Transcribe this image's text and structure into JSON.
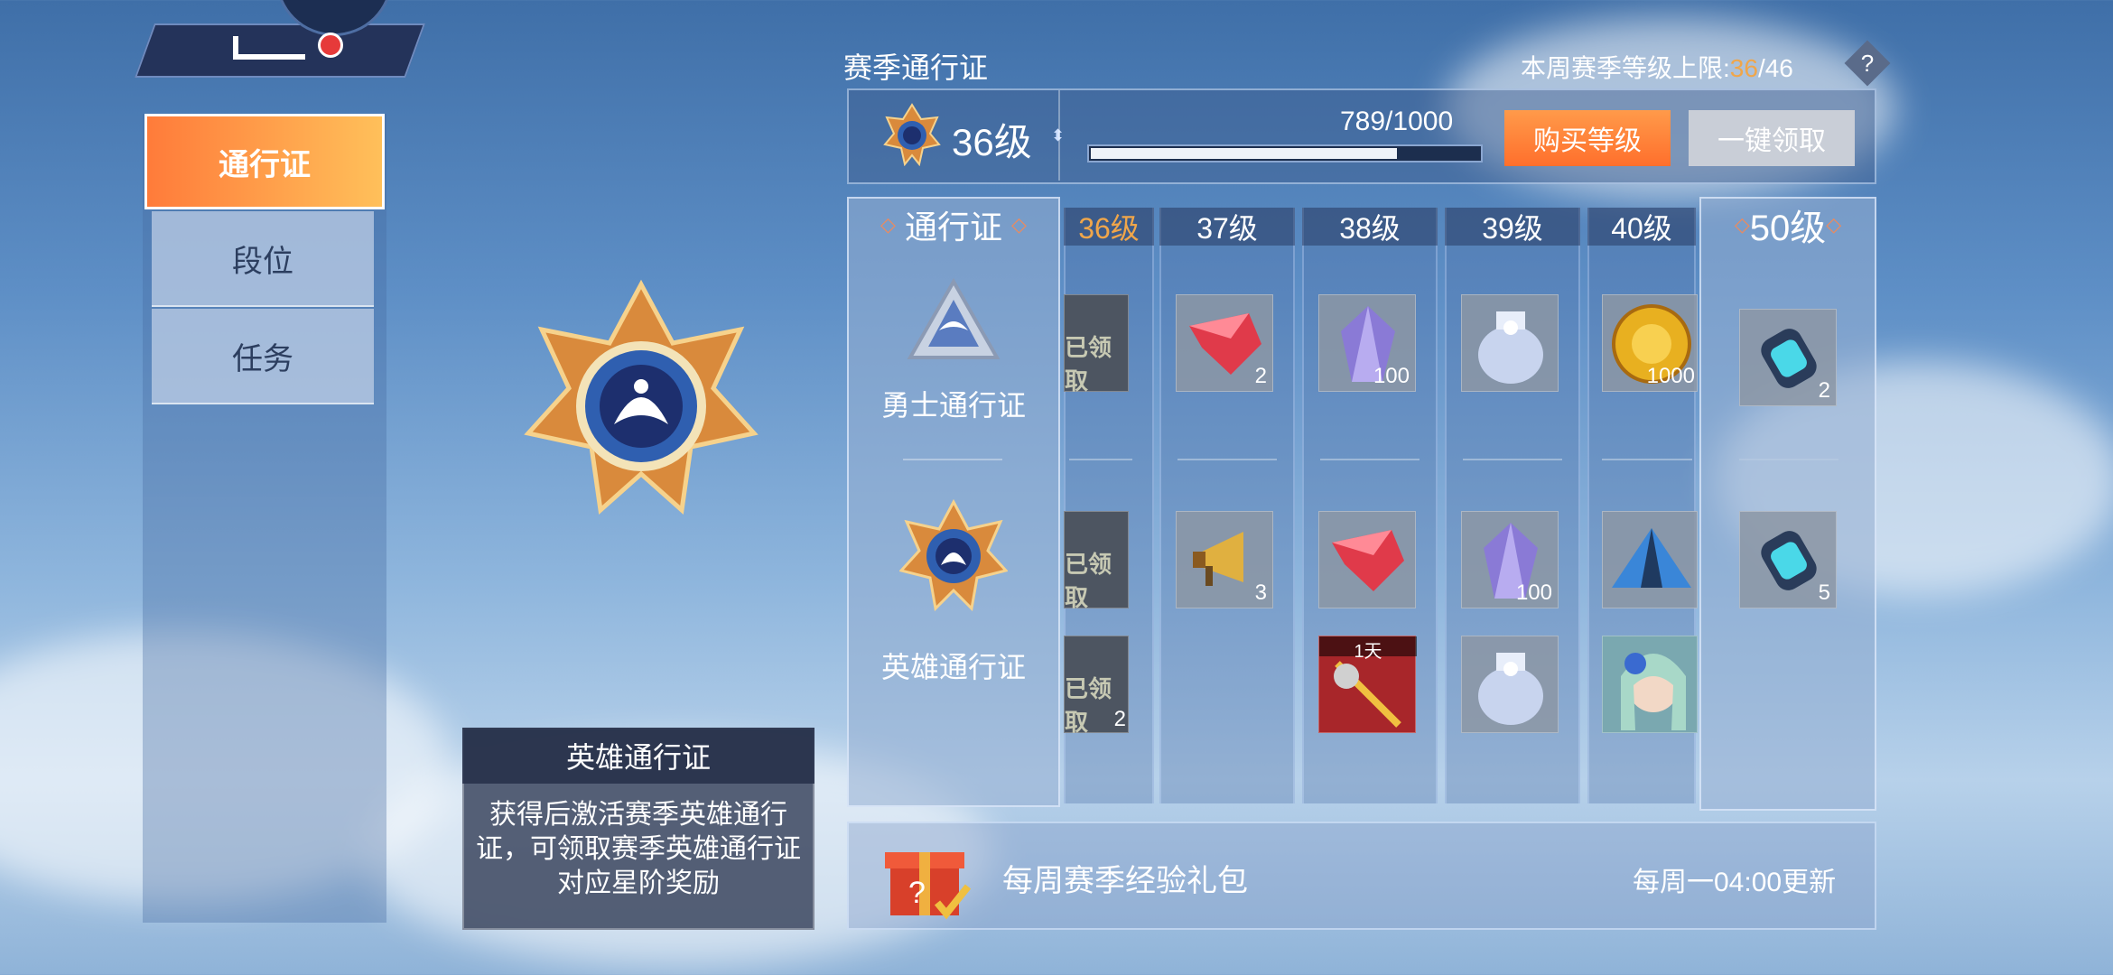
{
  "nav": {
    "tabs": [
      {
        "label": "通行证"
      },
      {
        "label": "段位"
      },
      {
        "label": "任务"
      }
    ]
  },
  "tooltip": {
    "title": "英雄通行证",
    "description": "获得后激活赛季英雄通行证，可领取赛季英雄通行证对应星阶奖励"
  },
  "header": {
    "title": "赛季通行证",
    "weekly_cap_label": "本周赛季等级上限:",
    "weekly_cap_current": "36",
    "weekly_cap_max": "/46",
    "help": "?"
  },
  "level": {
    "text": "36级",
    "xp": "789/1000",
    "progress": 0.789,
    "buy_label": "购买等级",
    "claim_label": "一键领取"
  },
  "pass_column": {
    "header": "通行证",
    "free_label": "勇士通行证",
    "hero_label": "英雄通行证"
  },
  "levels": [
    {
      "label": "36级"
    },
    {
      "label": "37级"
    },
    {
      "label": "38级"
    },
    {
      "label": "39级"
    },
    {
      "label": "40级"
    },
    {
      "label": "50级"
    }
  ],
  "claimed_label": "已领取",
  "rewards": {
    "free": [
      "",
      "2",
      "100",
      "",
      "1000",
      "2"
    ],
    "hero1": [
      "",
      "3",
      "",
      "100",
      "",
      "5"
    ],
    "hero2": [
      "2",
      "",
      "",
      "",
      "",
      ""
    ],
    "duration_tag": "1天"
  },
  "weekly": {
    "label": "每周赛季经验礼包",
    "reset": "每周一04:00更新"
  },
  "colors": {
    "accent_orange": "#ff7b3a",
    "level_highlight": "#f0a64a",
    "grey_button": "#c9ced7"
  }
}
